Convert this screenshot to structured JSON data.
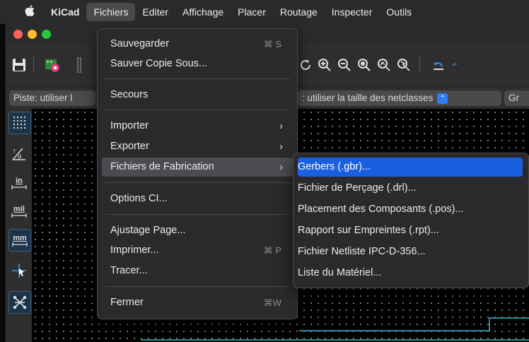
{
  "menubar": {
    "app": "KiCad",
    "items": [
      "Fichiers",
      "Editer",
      "Affichage",
      "Placer",
      "Routage",
      "Inspecter",
      "Outils"
    ]
  },
  "optbar": {
    "track_combo": "Piste: utiliser l",
    "via_combo": ": utiliser la taille des netclasses",
    "grid_combo": "Gr"
  },
  "left_toolbar": {
    "units_in": "in",
    "units_mil": "mil",
    "units_mm": "mm"
  },
  "fichiers_menu": {
    "items": [
      {
        "label": "Sauvegarder",
        "shortcut": "⌘ S"
      },
      {
        "label": "Sauver Copie Sous...",
        "shortcut": ""
      },
      {
        "label": "Secours",
        "shortcut": ""
      },
      {
        "label": "Importer",
        "shortcut": ""
      },
      {
        "label": "Exporter",
        "shortcut": ""
      },
      {
        "label": "Fichiers de Fabrication",
        "shortcut": ""
      },
      {
        "label": "Options CI...",
        "shortcut": ""
      },
      {
        "label": "Ajustage Page...",
        "shortcut": ""
      },
      {
        "label": "Imprimer...",
        "shortcut": "⌘ P"
      },
      {
        "label": "Tracer...",
        "shortcut": ""
      },
      {
        "label": "Fermer",
        "shortcut": "⌘W"
      }
    ]
  },
  "fabrication_submenu": {
    "items": [
      "Gerbers (.gbr)...",
      "Fichier de Perçage (.drl)...",
      "Placement des Composants (.pos)...",
      "Rapport sur Empreintes (.rpt)...",
      "Fichier Netliste IPC-D-356...",
      "Liste du Matériel..."
    ]
  },
  "colors": {
    "menu_bg": "#2a2a2c",
    "highlight": "#4c4c50",
    "selection_blue": "#1a5fe0",
    "trace": "#2c8c9a"
  }
}
